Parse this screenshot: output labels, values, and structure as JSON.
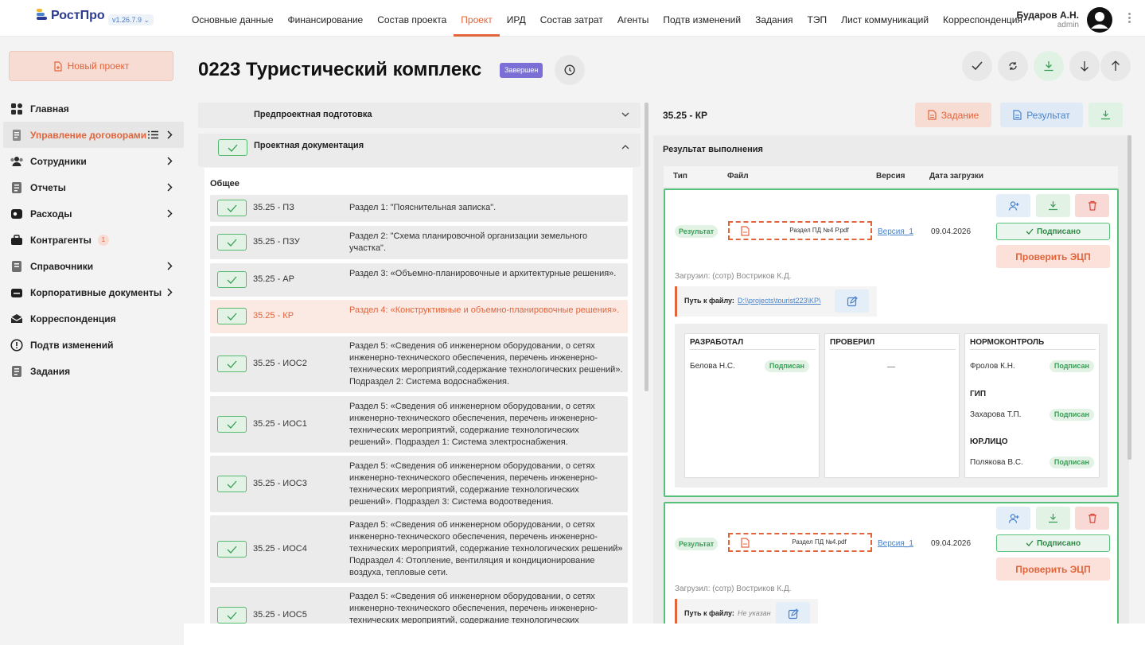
{
  "brand": {
    "name_a": "Рост",
    "name_b": "Про",
    "version": "v1.26.7.9 ⌄"
  },
  "mainnav": [
    {
      "label": "Основные данные"
    },
    {
      "label": "Финансирование"
    },
    {
      "label": "Состав проекта"
    },
    {
      "label": "Проект"
    },
    {
      "label": "ИРД"
    },
    {
      "label": "Состав затрат"
    },
    {
      "label": "Агенты"
    },
    {
      "label": "Подтв изменений"
    },
    {
      "label": "Задания"
    },
    {
      "label": "ТЭП"
    },
    {
      "label": "Лист коммуникаций"
    },
    {
      "label": "Корреспонденция"
    }
  ],
  "active_tab": "Проект",
  "user": {
    "name": "Бударов А.Н.",
    "role": "admin"
  },
  "sidebar": {
    "new_project": "Новый проект",
    "items": [
      {
        "label": "Главная",
        "icon": "dashboard-icon"
      },
      {
        "label": "Управление договорами",
        "icon": "documents-icon"
      },
      {
        "label": "Сотрудники",
        "icon": "users-icon"
      },
      {
        "label": "Отчеты",
        "icon": "report-icon"
      },
      {
        "label": "Расходы",
        "icon": "wallet-icon"
      },
      {
        "label": "Контрагенты",
        "icon": "briefcase-icon",
        "badge": "1"
      },
      {
        "label": "Справочники",
        "icon": "book-icon"
      },
      {
        "label": "Корпоративные документы",
        "icon": "folder-icon"
      },
      {
        "label": "Корреспонденция",
        "icon": "mail-icon"
      },
      {
        "label": "Подтв изменений",
        "icon": "alert-icon"
      },
      {
        "label": "Задания",
        "icon": "task-icon"
      }
    ]
  },
  "page": {
    "title": "0223 Туристический комплекс",
    "status": "Завершен"
  },
  "sections": {
    "predproekt": "Предпроектная подготовка",
    "proektdoc": "Проектная документация",
    "group": "Общее"
  },
  "rows": [
    {
      "code": "35.25 - ПЗ",
      "desc": "Раздел 1: \"Пояснительная записка\"."
    },
    {
      "code": "35.25 - ПЗУ",
      "desc": "Раздел 2: \"Схема планировочной организации земельного участка\"."
    },
    {
      "code": "35.25 - АР",
      "desc": "Раздел 3: «Объемно-планировочные и архитектурные решения»."
    },
    {
      "code": "35.25 - КР",
      "desc": "Раздел 4: «Конструктивные и объемно-планировочные решения»."
    },
    {
      "code": "35.25 - ИОС2",
      "desc": "Раздел 5: «Сведения об инженерном оборудовании, о сетях инженерно-технического обеспечения, перечень инженерно-технических мероприятий,содержание технологических решений». Подраздел 2: Система водоснабжения."
    },
    {
      "code": "35.25 - ИОС1",
      "desc": "Раздел 5: «Сведения об инженерном оборудовании, о сетях инженерно-технического обеспечения, перечень инженерно-технических мероприятий, содержание технологических решений». Подраздел 1: Система электроснабжения."
    },
    {
      "code": "35.25 - ИОС3",
      "desc": "Раздел 5: «Сведения об инженерном оборудовании, о сетях инженерно-технического обеспечения, перечень инженерно-технических мероприятий, содержание технологических решений». Подраздел 3: Система водоотведения."
    },
    {
      "code": "35.25 - ИОС4",
      "desc": "Раздел 5: «Сведения об инженерном оборудовании, о сетях инженерно-технического обеспечения, перечень инженерно-технических мероприятий, содержание технологических решений» Подраздел 4: Отопление, вентиляция и кондиционирование воздуха, тепловые сети."
    },
    {
      "code": "35.25 - ИОС5",
      "desc": "Раздел 5: «Сведения об инженерном оборудовании, о сетях инженерно-технического обеспечения, перечень инженерно-технических мероприятий, содержание технологических решений»."
    }
  ],
  "right": {
    "code": "35.25 - КР",
    "btn_task": "Задание",
    "btn_result": "Результат",
    "result_title": "Результат выполнения",
    "headers": {
      "type": "Тип",
      "file": "Файл",
      "version": "Версия",
      "date": "Дата загрузки"
    },
    "cards": [
      {
        "tag": "Результат",
        "file": "Раздел ПД №4 Р.pdf",
        "version": "Версия_1",
        "date": "09.04.2026",
        "signed": "Подписано",
        "ecp": "Проверить ЭЦП",
        "uploader": "Загрузил: (сотр) Востриков К.Д.",
        "path_label": "Путь к файлу:",
        "path": "D:\\\\projects\\tourist223\\KP\\",
        "sign": {
          "dev_h": "РАЗРАБОТАЛ",
          "dev_n": "Белова Н.С.",
          "chk_h": "ПРОВЕРИЛ",
          "chk_empty": "—",
          "norm_h": "НОРМОКОНТРОЛЬ",
          "norm_n": "Фролов К.Н.",
          "gip_h": "ГИП",
          "gip_n": "Захарова Т.П.",
          "jur_h": "ЮР.ЛИЦО",
          "jur_n": "Полякова В.С.",
          "badge": "Подписан"
        }
      },
      {
        "tag": "Результат",
        "file": "Раздел ПД №4.pdf",
        "version": "Версия_1",
        "date": "09.04.2026",
        "signed": "Подписано",
        "ecp": "Проверить ЭЦП",
        "uploader": "Загрузил: (сотр) Востриков К.Д.",
        "path_label": "Путь к файлу:",
        "path": "Не указан"
      }
    ]
  },
  "colors": {
    "accent": "#e2643b",
    "green": "#56c17a",
    "blue": "#4a82c8",
    "status": "#7b6fd6"
  }
}
